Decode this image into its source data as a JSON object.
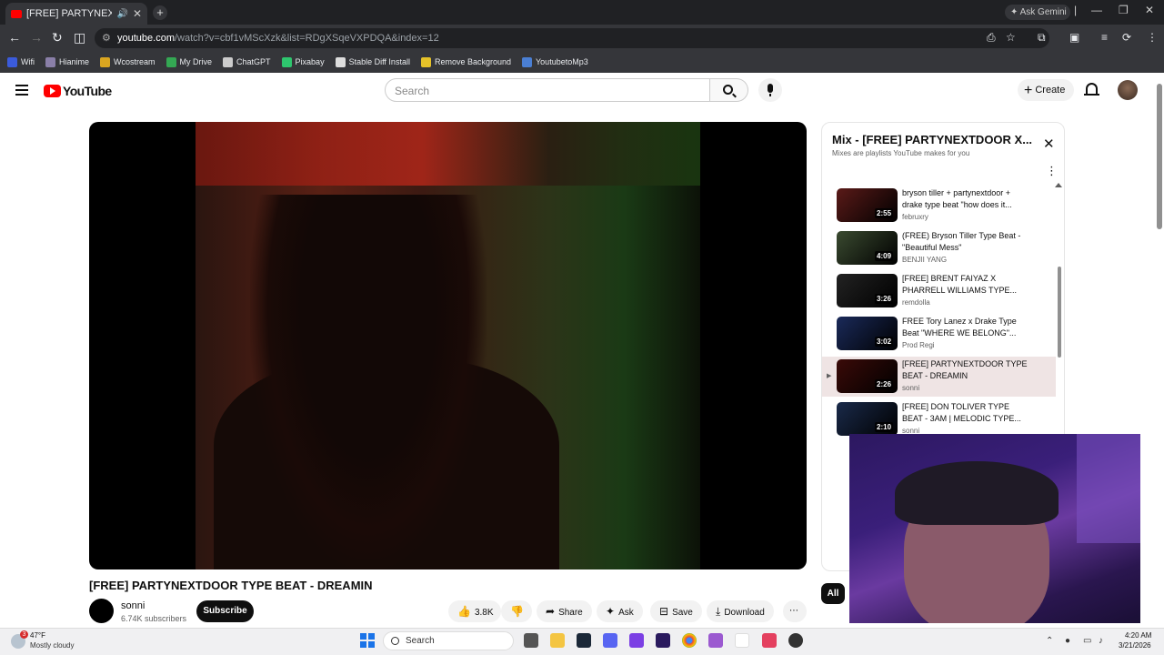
{
  "browser": {
    "tab_title": "[FREE] PARTYNEXTDOOR TYPE BEAT - DREAMIN",
    "new_tab": "+",
    "gemini_label": "Ask Gemini",
    "url_domain": "youtube.com",
    "url_path": "/watch?v=cbf1vMScXzk&list=RDgXSqeVXPDQA&index=12",
    "bookmarks": [
      {
        "label": "Wifi",
        "color": "#3b5bdb"
      },
      {
        "label": "Hianime",
        "color": "#8a7fa8"
      },
      {
        "label": "Wcostream",
        "color": "#d9a520"
      },
      {
        "label": "My Drive",
        "color": "#34a853"
      },
      {
        "label": "ChatGPT",
        "color": "#cccccc"
      },
      {
        "label": "Pixabay",
        "color": "#2ec66e"
      },
      {
        "label": "Stable Diff Install",
        "color": "#dddddd"
      },
      {
        "label": "Remove Background",
        "color": "#e6c229"
      },
      {
        "label": "YoutubetoMp3",
        "color": "#4a7fd4"
      }
    ]
  },
  "youtube": {
    "logo_text": "YouTube",
    "search_placeholder": "Search",
    "create_label": "Create",
    "video_title": "[FREE] PARTYNEXTDOOR TYPE BEAT - DREAMIN",
    "channel_name": "sonni",
    "channel_subs": "6.74K subscribers",
    "subscribe_label": "Subscribe",
    "actions": {
      "likes": "3.8K",
      "share": "Share",
      "ask": "Ask",
      "save": "Save",
      "download": "Download",
      "more": "⋯"
    },
    "chip_all": "All"
  },
  "playlist": {
    "title": "Mix - [FREE] PARTYNEXTDOOR X...",
    "subtitle": "Mixes are playlists YouTube makes for you",
    "items": [
      {
        "title": "bryson tiller + partynextdoor + drake type beat \"how does it...",
        "channel": "februxry",
        "duration": "2:55",
        "thumb": "#5a1a18",
        "active": false
      },
      {
        "title": "(FREE) Bryson Tiller Type Beat - \"Beautiful Mess\"",
        "channel": "BENJII YANG",
        "duration": "4:09",
        "thumb": "#3a4a30",
        "active": false
      },
      {
        "title": "[FREE] BRENT FAIYAZ X PHARRELL WILLIAMS TYPE...",
        "channel": "remdolla",
        "duration": "3:26",
        "thumb": "#222222",
        "active": false
      },
      {
        "title": "FREE Tory Lanez x Drake Type Beat \"WHERE WE BELONG\"...",
        "channel": "Prod Regi",
        "duration": "3:02",
        "thumb": "#1a2a5a",
        "active": false
      },
      {
        "title": "[FREE] PARTYNEXTDOOR TYPE BEAT - DREAMIN",
        "channel": "sonni",
        "duration": "2:26",
        "thumb": "#3a0a08",
        "active": true
      },
      {
        "title": "[FREE] DON TOLIVER TYPE BEAT - 3AM | MELODIC TYPE...",
        "channel": "sonni",
        "duration": "2:10",
        "thumb": "#1a2a4a",
        "active": false
      }
    ]
  },
  "taskbar": {
    "temperature": "47°F",
    "weather": "Mostly cloudy",
    "weather_badge": "3",
    "search": "Search",
    "time": "4:20 AM",
    "date": "3/21/2026"
  }
}
